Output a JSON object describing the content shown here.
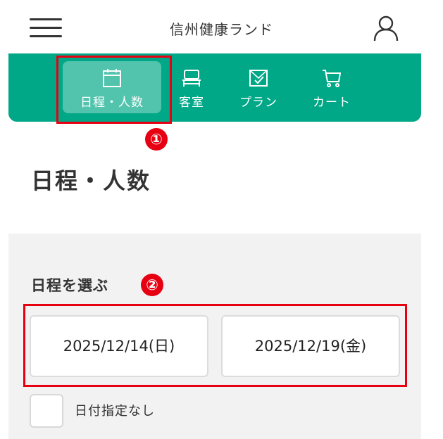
{
  "header": {
    "title": "信州健康ランド",
    "menu_icon": "hamburger-menu-icon",
    "user_icon": "user-account-icon"
  },
  "nav": {
    "items": [
      {
        "label": "日程・人数",
        "icon": "calendar-icon",
        "active": true
      },
      {
        "label": "客室",
        "icon": "bed-icon",
        "active": false
      },
      {
        "label": "プラン",
        "icon": "checkbox-plan-icon",
        "active": false
      },
      {
        "label": "カート",
        "icon": "cart-icon",
        "active": false
      }
    ]
  },
  "annotations": {
    "marker1": "①",
    "marker2": "②"
  },
  "page": {
    "title": "日程・人数"
  },
  "date_section": {
    "title": "日程を選ぶ",
    "checkin": "2025/12/14(日)",
    "checkout": "2025/12/19(金)",
    "no_date_label": "日付指定なし"
  },
  "colors": {
    "brand": "#00a887",
    "highlight": "#e60012"
  }
}
